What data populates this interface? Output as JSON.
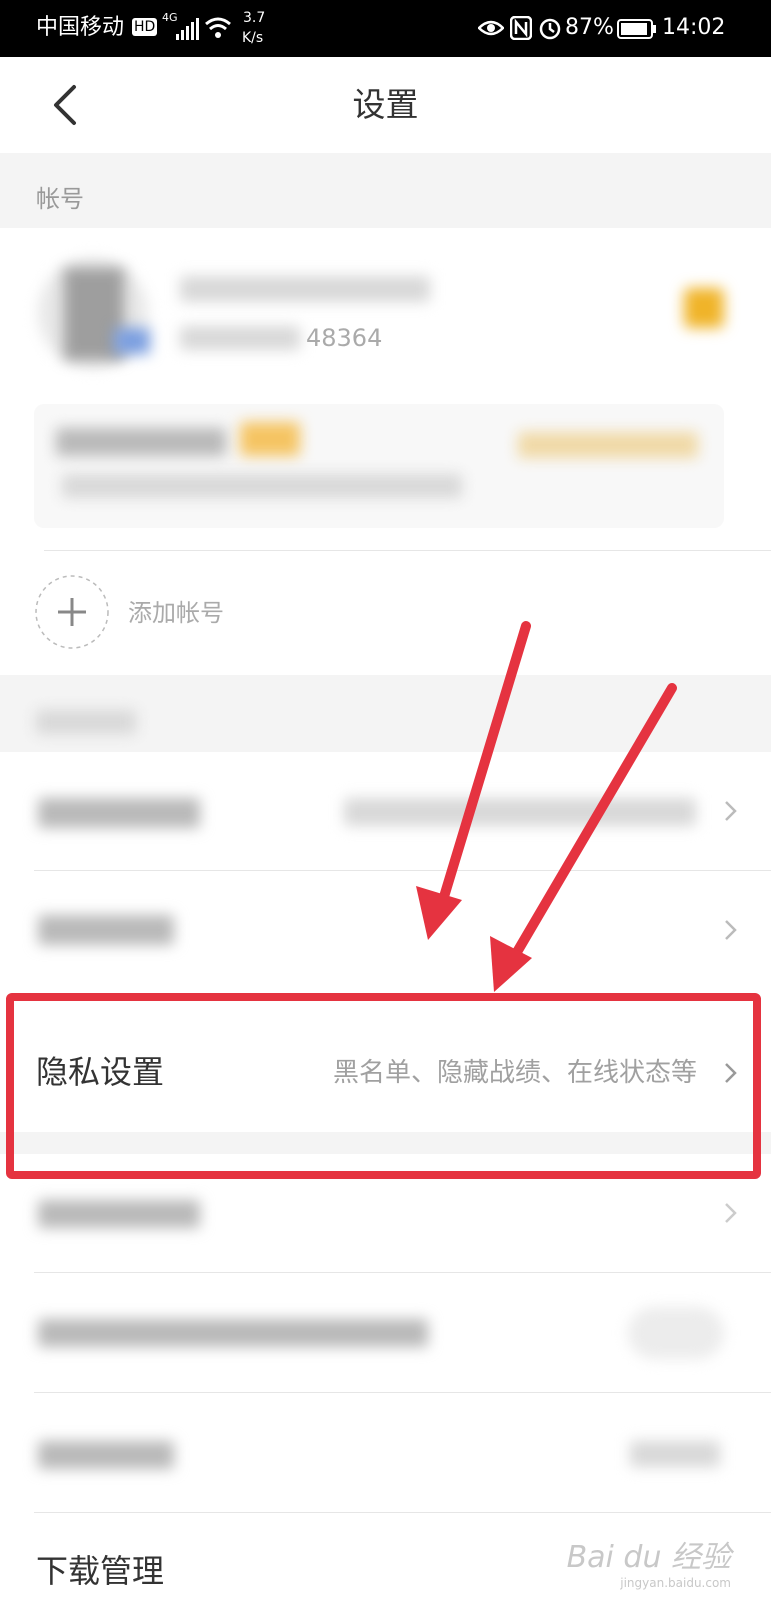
{
  "status_bar": {
    "carrier": "中国移动",
    "hd": "HD",
    "net_type": "4G",
    "speed_value": "3.7",
    "speed_unit": "K/s",
    "battery": "87%",
    "time": "14:02"
  },
  "header": {
    "title": "设置"
  },
  "account": {
    "section_label": "帐号",
    "phone_suffix": "48364",
    "add_account_label": "添加帐号"
  },
  "privacy": {
    "label": "隐私设置",
    "description": "黑名单、隐藏战绩、在线状态等"
  },
  "download": {
    "label": "下载管理"
  },
  "watermark": {
    "brand": "Bai du 经验",
    "url": "jingyan.baidu.com"
  },
  "colors": {
    "highlight": "#e53340",
    "arrow": "#e53340",
    "accent_gold": "#f0b429"
  }
}
